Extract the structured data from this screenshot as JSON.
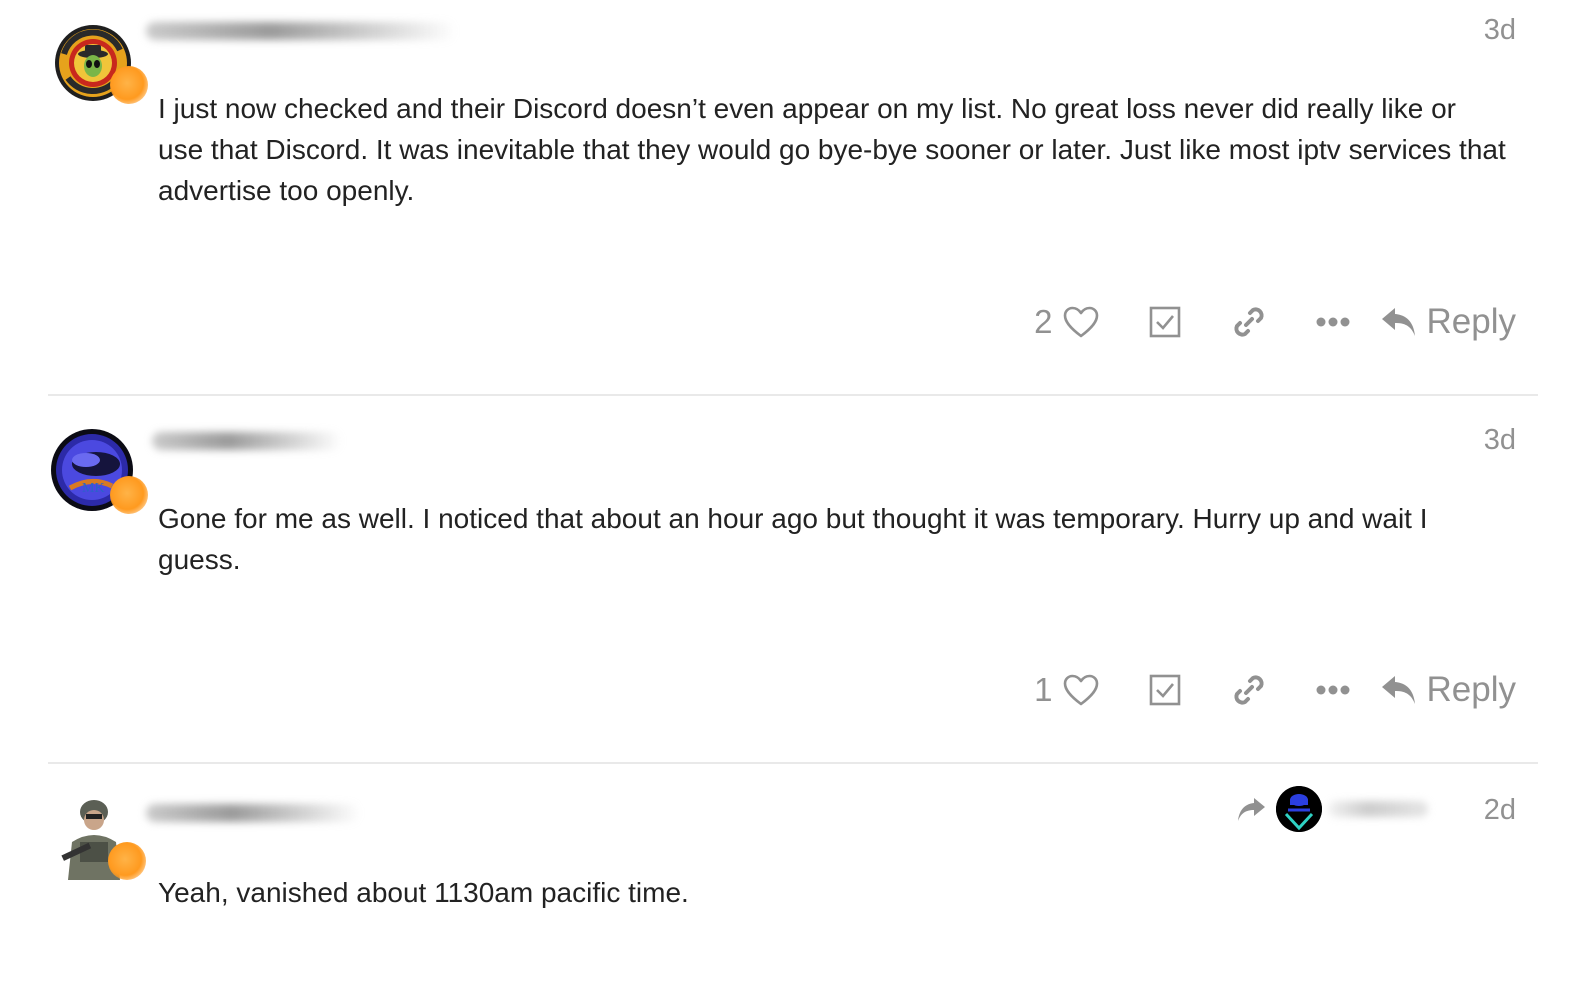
{
  "posts": [
    {
      "date": "3d",
      "body": "I just now checked and their Discord doesn’t even appear on my list. No great loss never did really like or use that Discord. It was inevitable that they would go bye-bye sooner or later. Just like most iptv services that advertise too openly.",
      "like_count": "2",
      "reply_label": "Reply"
    },
    {
      "date": "3d",
      "body": "Gone for me as well. I noticed that about an hour ago but thought it was temporary. Hurry up and wait I guess.",
      "like_count": "1",
      "reply_label": "Reply"
    },
    {
      "date": "2d",
      "body": "Yeah, vanished about 1130am pacific time."
    }
  ],
  "colors": {
    "text": "#222222",
    "muted": "#919191",
    "divider": "#e9e9e9",
    "status_dot": "#ff9a1f"
  },
  "icons": {
    "like": "heart-outline-icon",
    "solved": "checkbox-check-icon",
    "share": "link-icon",
    "more": "ellipsis-icon",
    "reply": "reply-arrow-icon",
    "reply_to": "share-arrow-icon"
  }
}
